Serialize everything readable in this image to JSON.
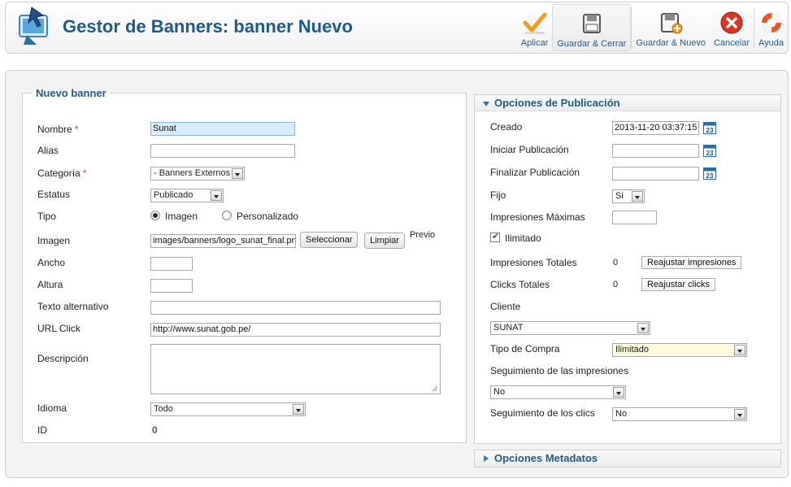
{
  "header": {
    "title": "Gestor de Banners: banner Nuevo",
    "toolbar": [
      {
        "label": "Aplicar",
        "icon": "check-icon"
      },
      {
        "label": "Guardar & Cerrar",
        "icon": "save-icon"
      },
      {
        "label": "Guardar & Nuevo",
        "icon": "save-new-icon"
      },
      {
        "label": "Cancelar",
        "icon": "cancel-icon"
      },
      {
        "label": "Ayuda",
        "icon": "help-lifebuoy-icon"
      }
    ]
  },
  "left": {
    "legend": "Nuevo banner",
    "nombre": {
      "label": "Nombre",
      "value": "Sunat"
    },
    "alias": {
      "label": "Alias",
      "value": ""
    },
    "categoria": {
      "label": "Categoría",
      "value": "- Banners Externos"
    },
    "estatus": {
      "label": "Estatus",
      "value": "Publicado"
    },
    "tipo": {
      "label": "Tipo",
      "opt1": "Imagen",
      "opt2": "Personalizado",
      "selected": "Imagen"
    },
    "imagen": {
      "label": "Imagen",
      "value": "images/banners/logo_sunat_final.png",
      "select_btn": "Seleccionar",
      "clear_btn": "Limpiar",
      "preview": "Previo"
    },
    "ancho": {
      "label": "Ancho",
      "value": ""
    },
    "altura": {
      "label": "Altura",
      "value": ""
    },
    "alt": {
      "label": "Texto alternativo",
      "value": ""
    },
    "url": {
      "label": "URL Click",
      "value": "http://www.sunat.gob.pe/"
    },
    "descripcion": {
      "label": "Descripción",
      "value": ""
    },
    "idioma": {
      "label": "Idioma",
      "value": "Todo"
    },
    "id": {
      "label": "ID",
      "value": "0"
    }
  },
  "publish": {
    "title": "Opciones de Publicación",
    "creado": {
      "label": "Creado",
      "value": "2013-11-20 03:37:15"
    },
    "iniciar": {
      "label": "Iniciar Publicación",
      "value": ""
    },
    "finalizar": {
      "label": "Finalizar Publicación",
      "value": ""
    },
    "fijo": {
      "label": "Fijo",
      "value": "Si"
    },
    "imp_max": {
      "label": "Impresiones Máximas",
      "value": ""
    },
    "ilimitado": {
      "label": "Ilimitado",
      "checked": true
    },
    "imp_totales": {
      "label": "Impresiones Totales",
      "value": "0",
      "btn": "Reajustar impresiones"
    },
    "clicks_totales": {
      "label": "Clicks Totales",
      "value": "0",
      "btn": "Reajustar clicks"
    },
    "cliente": {
      "label": "Cliente",
      "value": "SUNAT"
    },
    "tipo_compra": {
      "label": "Tipo de Compra",
      "value": "Ilimitado"
    },
    "seg_imp": {
      "label": "Seguimiento de las impresiones",
      "value": "No"
    },
    "seg_clics": {
      "label": "Seguimiento de los clics",
      "value": "No"
    }
  },
  "metadata": {
    "title": "Opciones Metadatos"
  },
  "colors": {
    "accent": "#1e5a87",
    "required": "#d23b2a",
    "highlight": "#d8ecfb",
    "yellow_field": "#fdfbd9"
  }
}
